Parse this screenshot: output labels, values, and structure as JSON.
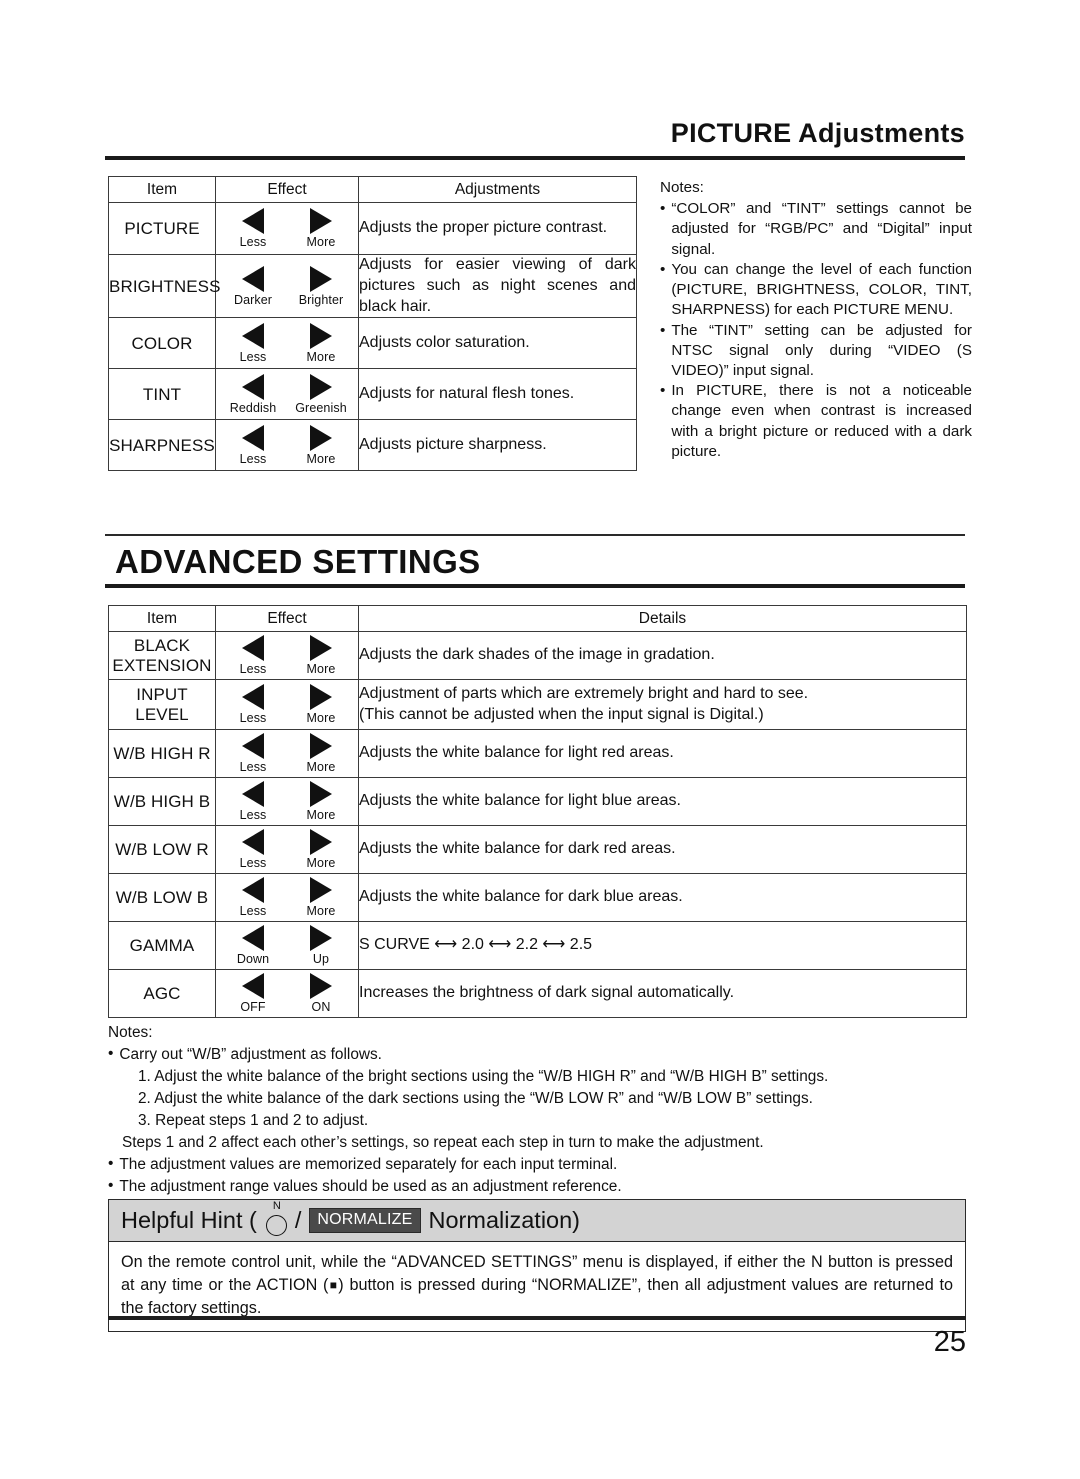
{
  "document": {
    "page_number": "25"
  },
  "section1": {
    "title": "PICTURE Adjustments",
    "table": {
      "headers": [
        "Item",
        "Effect",
        "Adjustments"
      ],
      "rows": [
        {
          "item": "PICTURE",
          "left_label": "Less",
          "right_label": "More",
          "description": "Adjusts the proper picture contrast."
        },
        {
          "item": "BRIGHTNESS",
          "left_label": "Darker",
          "right_label": "Brighter",
          "description": "Adjusts for easier viewing of dark pictures such as night scenes and black hair."
        },
        {
          "item": "COLOR",
          "left_label": "Less",
          "right_label": "More",
          "description": "Adjusts color saturation."
        },
        {
          "item": "TINT",
          "left_label": "Reddish",
          "right_label": "Greenish",
          "description": "Adjusts for natural flesh tones."
        },
        {
          "item": "SHARPNESS",
          "left_label": "Less",
          "right_label": "More",
          "description": "Adjusts picture sharpness."
        }
      ]
    },
    "notes": {
      "title": "Notes:",
      "bullet": "•",
      "items": [
        "“COLOR” and “TINT” settings cannot be adjusted for “RGB/PC” and “Digital” input signal.",
        "You can change the level of each function (PICTURE, BRIGHTNESS, COLOR, TINT, SHARPNESS) for each PICTURE MENU.",
        "The “TINT” setting can be adjusted for NTSC signal only during “VIDEO (S VIDEO)” input signal.",
        "In PICTURE, there is not a noticeable change even when contrast is increased with a bright picture or reduced with a dark picture."
      ]
    }
  },
  "section2": {
    "title": "ADVANCED SETTINGS",
    "table": {
      "headers": [
        "Item",
        "Effect",
        "Details"
      ],
      "rows": [
        {
          "item": "BLACK EXTENSION",
          "item_line1": "BLACK",
          "item_line2": "EXTENSION",
          "left_label": "Less",
          "right_label": "More",
          "description": "Adjusts the dark shades of the image in gradation."
        },
        {
          "item": "INPUT LEVEL",
          "item_line1": "INPUT",
          "item_line2": "LEVEL",
          "left_label": "Less",
          "right_label": "More",
          "description": "Adjustment of parts which are extremely bright and hard to see.",
          "description2": "(This cannot be adjusted when the input signal is Digital.)"
        },
        {
          "item": "W/B HIGH R",
          "left_label": "Less",
          "right_label": "More",
          "description": "Adjusts the white balance for light red areas."
        },
        {
          "item": "W/B HIGH B",
          "left_label": "Less",
          "right_label": "More",
          "description": "Adjusts the white balance for light blue areas."
        },
        {
          "item": "W/B LOW R",
          "left_label": "Less",
          "right_label": "More",
          "description": "Adjusts the white balance for dark red areas."
        },
        {
          "item": "W/B LOW B",
          "left_label": "Less",
          "right_label": "More",
          "description": "Adjusts the white balance for dark blue areas."
        },
        {
          "item": "GAMMA",
          "left_label": "Down",
          "right_label": "Up",
          "description": "S CURVE ⟷ 2.0 ⟷ 2.2 ⟷ 2.5"
        },
        {
          "item": "AGC",
          "left_label": "OFF",
          "right_label": "ON",
          "description": "Increases the brightness of dark signal automatically."
        }
      ]
    },
    "notes": {
      "title": "Notes:",
      "bullet": "•",
      "line1": "Carry out “W/B” adjustment as follows.",
      "step1": "1. Adjust the white balance of the bright sections using the “W/B HIGH R” and “W/B HIGH B” settings.",
      "step2": "2. Adjust the white balance of the dark sections using the “W/B LOW R” and “W/B LOW B” settings.",
      "step3": "3. Repeat steps 1 and 2 to adjust.",
      "line2": "Steps 1 and 2 affect each other’s settings, so repeat each step in turn to make the adjustment.",
      "line3": "The adjustment values are memorized separately for each input terminal.",
      "line4": "The adjustment range values should be used as an adjustment reference."
    }
  },
  "hint": {
    "prefix": "Helpful Hint (",
    "n_label": "N",
    "slash": "/",
    "badge": "NORMALIZE",
    "suffix": "Normalization)",
    "body_1": "On the remote control unit, while the “ADVANCED SETTINGS” menu is displayed, if either the N button is pressed at any time or the ACTION (",
    "body_square": "■",
    "body_2": ") button is pressed during “NORMALIZE”, then all adjustment values are returned to the factory settings."
  }
}
